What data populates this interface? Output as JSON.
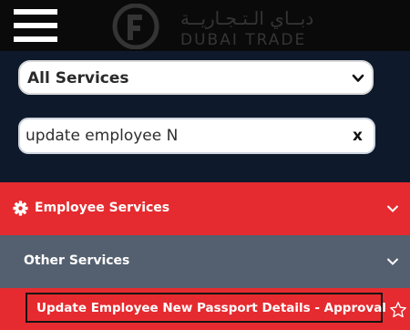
{
  "header": {
    "menu_icon": "hamburger-menu-icon",
    "logo_arabic": "دبــاي الـتـجـاريــة",
    "logo_english": "DUBAI TRADE"
  },
  "filters": {
    "service_select": "All Services",
    "search_value": "update employee N",
    "clear_label": "x"
  },
  "menu": {
    "employee_services": {
      "label": "Employee Services",
      "icon": "gear-icon"
    },
    "other_services": {
      "label": "Other Services"
    },
    "result_item": {
      "label": "Update Employee New Passport Details - Approval",
      "icon": "star-icon"
    }
  },
  "colors": {
    "header_bg": "#0a0a0a",
    "panel_bg": "#0e1a2c",
    "accent_red": "#e52b2f",
    "submenu_gray": "#545f6f"
  }
}
